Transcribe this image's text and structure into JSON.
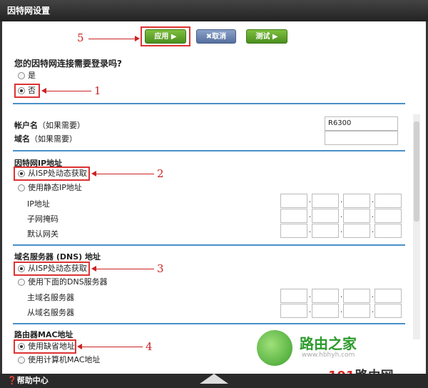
{
  "window": {
    "title": "因特网设置"
  },
  "toolbar": {
    "apply_label": "应用 ▶",
    "cancel_label": "✖取消",
    "test_label": "测试 ▶"
  },
  "annotations": {
    "n1": "1",
    "n2": "2",
    "n3": "3",
    "n4": "4",
    "n5": "5"
  },
  "login": {
    "question": "您的因特网连接需要登录吗?",
    "options": [
      {
        "label": "是",
        "selected": false
      },
      {
        "label": "否",
        "selected": true
      }
    ]
  },
  "account": {
    "account_label": "帐户名",
    "account_hint": "（如果需要）",
    "account_value": "R6300",
    "domain_label": "域名",
    "domain_hint": "（如果需要）",
    "domain_value": ""
  },
  "ip": {
    "heading": "因特网IP地址",
    "options": [
      {
        "label": "从ISP处动态获取",
        "selected": true
      },
      {
        "label": "使用静态IP地址",
        "selected": false
      }
    ],
    "fields": [
      "IP地址",
      "子网掩码",
      "默认网关"
    ]
  },
  "dns": {
    "heading": "域名服务器 (DNS) 地址",
    "options": [
      {
        "label": "从ISP处动态获取",
        "selected": true
      },
      {
        "label": "使用下面的DNS服务器",
        "selected": false
      }
    ],
    "fields": [
      "主域名服务器",
      "从域名服务器"
    ]
  },
  "mac": {
    "heading": "路由器MAC地址",
    "options": [
      {
        "label": "使用缺省地址",
        "selected": true
      },
      {
        "label": "使用计算机MAC地址",
        "selected": false
      }
    ]
  },
  "footer": {
    "help_label": "❓帮助中心"
  },
  "watermark": {
    "brand": "路由之家",
    "url": "www.hbhyh.com",
    "site_prefix": "191",
    "site_suffix": "路由网"
  },
  "colors": {
    "accent_line": "#4a90c8",
    "callout": "#cc2222",
    "button_green": "#5a9f2a",
    "button_blue": "#5d77a6"
  }
}
